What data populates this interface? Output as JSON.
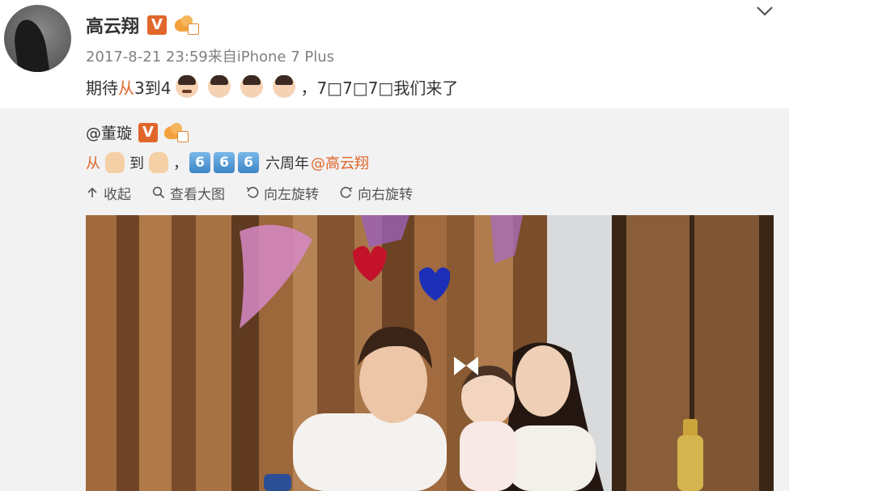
{
  "post": {
    "author_name": "高云翔",
    "verified_badge": "V",
    "meta": "2017-8-21 23:59来自iPhone 7 Plus",
    "text_prefix": "期待",
    "text_highlight": "从",
    "text_mid": "3到4",
    "text_suffix": "，7□7□7□我们来了",
    "emojis": [
      "boy-face",
      "girl-face",
      "girl-face",
      "girl-face"
    ]
  },
  "repost": {
    "author_name": "@董璇",
    "verified_badge": "V",
    "text_from": "从",
    "text_to": "到",
    "text_comma": "，",
    "tiles": [
      "6",
      "6",
      "6"
    ],
    "text_anniv": "六周年",
    "mention": "@高云翔",
    "actions": [
      {
        "label": "收起",
        "icon": "collapse-arrow-icon"
      },
      {
        "label": "查看大图",
        "icon": "search-icon"
      },
      {
        "label": "向左旋转",
        "icon": "rotate-left-icon"
      },
      {
        "label": "向右旋转",
        "icon": "rotate-right-icon"
      }
    ]
  },
  "colors": {
    "accent": "#e0662b",
    "repost_bg": "#f2f2f2",
    "meta_gray": "#808080",
    "tile_blue": "#3d86c6"
  }
}
